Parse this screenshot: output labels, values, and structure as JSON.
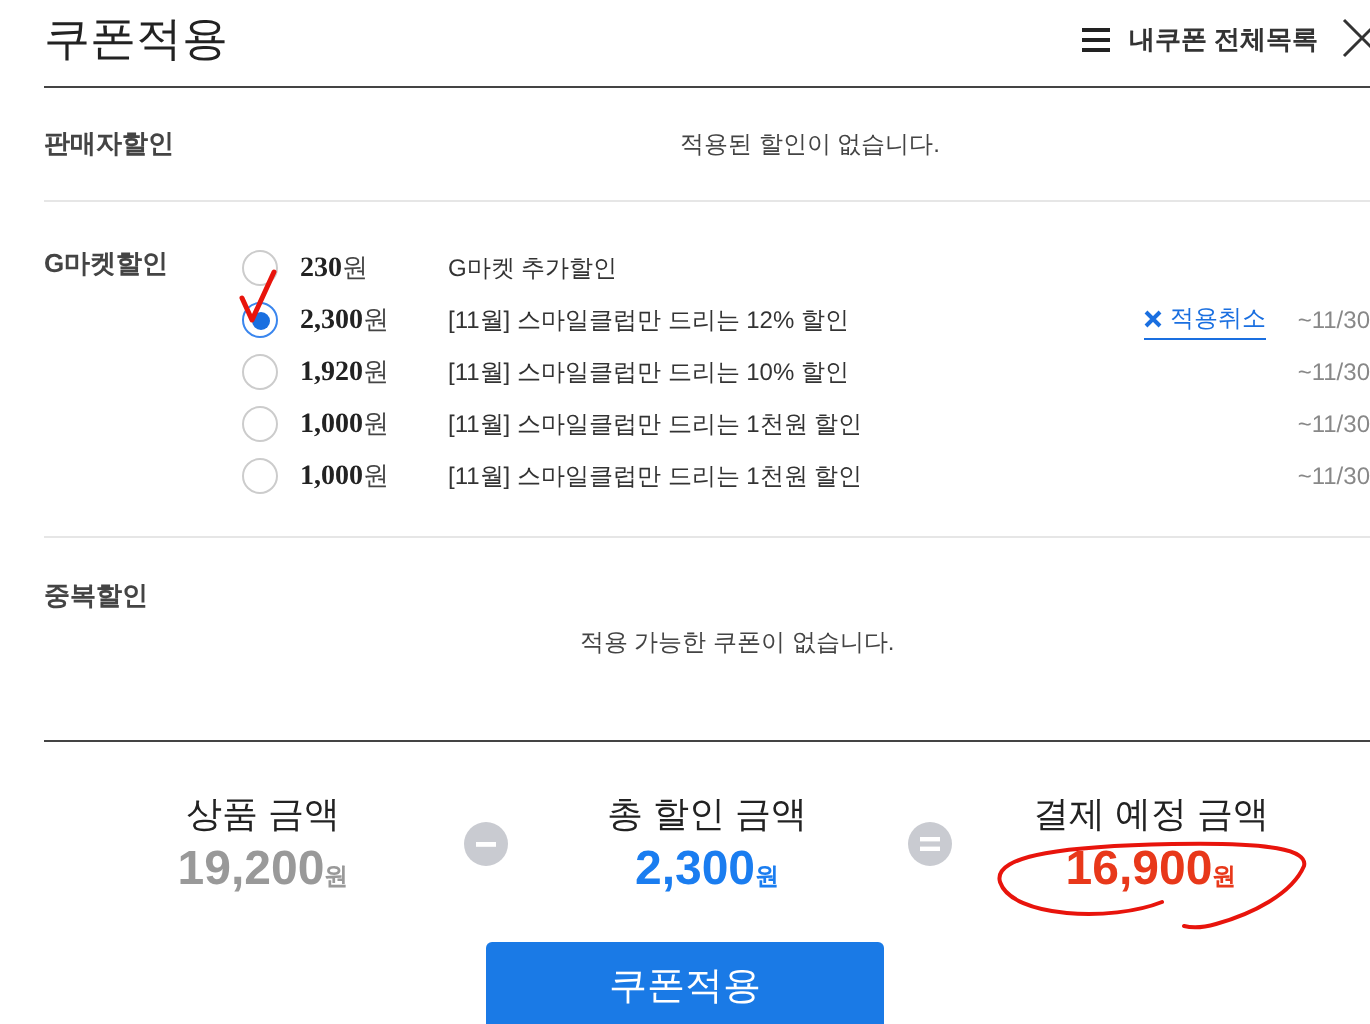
{
  "title": "쿠폰적용",
  "my_coupons_link": {
    "label": "내쿠폰 전체목록"
  },
  "seller_discount": {
    "label": "판매자할인",
    "message": "적용된 할인이 없습니다."
  },
  "gmarket_discount": {
    "label": "G마켓할인",
    "coupons": [
      {
        "amount": "230",
        "unit": "원",
        "description": "G마켓 추가할인",
        "selected": false
      },
      {
        "amount": "2,300",
        "unit": "원",
        "description": "[11월] 스마일클럽만 드리는 12% 할인",
        "selected": true,
        "hand_checked": true,
        "cancel_label": "적용취소",
        "expiry": "~11/30"
      },
      {
        "amount": "1,920",
        "unit": "원",
        "description": "[11월] 스마일클럽만 드리는 10% 할인",
        "selected": false,
        "expiry": "~11/30"
      },
      {
        "amount": "1,000",
        "unit": "원",
        "description": "[11월] 스마일클럽만 드리는 1천원 할인",
        "selected": false,
        "expiry": "~11/30"
      },
      {
        "amount": "1,000",
        "unit": "원",
        "description": "[11월] 스마일클럽만 드리는 1천원 할인",
        "selected": false,
        "expiry": "~11/30"
      }
    ]
  },
  "duplicate_discount": {
    "label": "중복할인",
    "message": "적용 가능한 쿠폰이 없습니다."
  },
  "summary": [
    {
      "kind": "product",
      "label": "상품 금액",
      "amount": "19,200",
      "unit": "원"
    },
    {
      "kind": "discount",
      "label": "총 할인 금액",
      "amount": "2,300",
      "unit": "원"
    },
    {
      "kind": "total",
      "label": "결제 예정 금액",
      "amount": "16,900",
      "unit": "원",
      "hand_circled": true
    }
  ],
  "apply_button": "쿠폰적용"
}
